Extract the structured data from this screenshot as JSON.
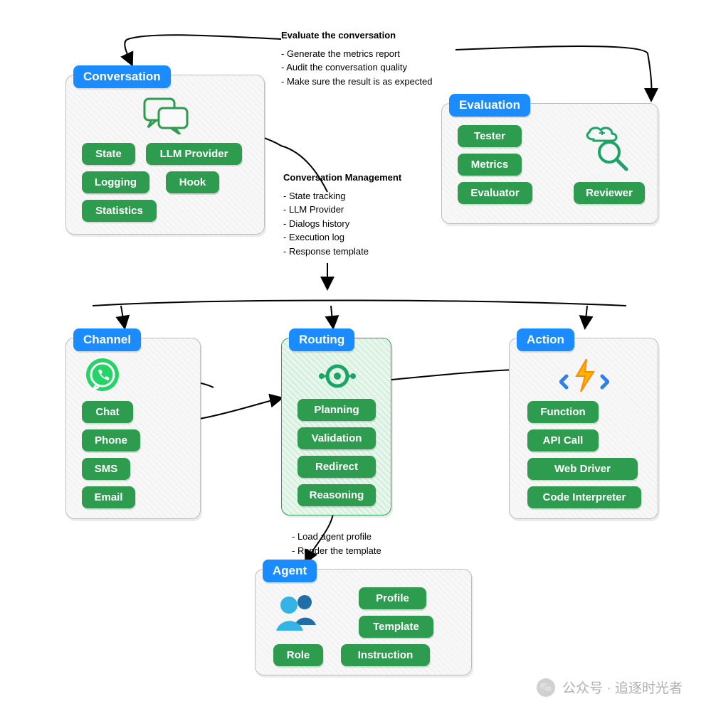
{
  "annotations": {
    "evaluate": {
      "title": "Evaluate the conversation",
      "bullets": [
        "- Generate the metrics report",
        "- Audit the conversation quality",
        "- Make sure the result is as expected"
      ]
    },
    "convmgmt": {
      "title": "Conversation Management",
      "bullets": [
        "- State tracking",
        "- LLM Provider",
        "- Dialogs history",
        "- Execution log",
        "- Response template"
      ]
    },
    "agent_notes": {
      "bullets": [
        "- Load agent profile",
        "- Render the template"
      ]
    }
  },
  "modules": {
    "conversation": {
      "title": "Conversation",
      "pills": [
        "State",
        "LLM Provider",
        "Logging",
        "Hook",
        "Statistics"
      ]
    },
    "evaluation": {
      "title": "Evaluation",
      "pills": [
        "Tester",
        "Metrics",
        "Evaluator",
        "Reviewer"
      ]
    },
    "channel": {
      "title": "Channel",
      "pills": [
        "Chat",
        "Phone",
        "SMS",
        "Email"
      ]
    },
    "routing": {
      "title": "Routing",
      "pills": [
        "Planning",
        "Validation",
        "Redirect",
        "Reasoning"
      ]
    },
    "action": {
      "title": "Action",
      "pills": [
        "Function",
        "API Call",
        "Web Driver",
        "Code Interpreter"
      ]
    },
    "agent": {
      "title": "Agent",
      "pills": [
        "Profile",
        "Template",
        "Role",
        "Instruction"
      ]
    }
  },
  "watermark": "公众号 · 追逐时光者"
}
